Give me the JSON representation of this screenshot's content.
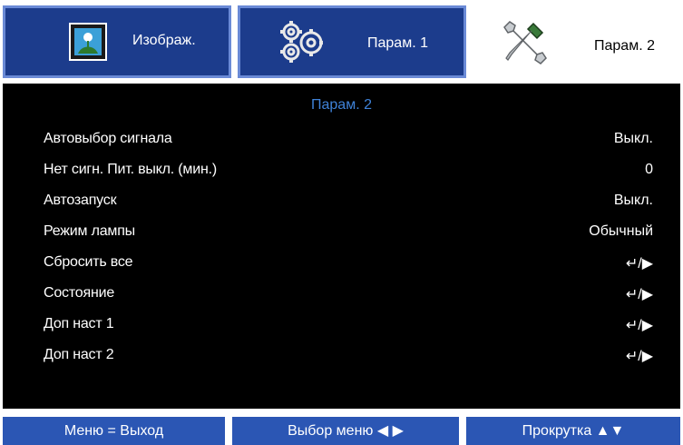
{
  "tabs": [
    {
      "label": "Изображ.",
      "icon": "image-icon"
    },
    {
      "label": "Парам. 1",
      "icon": "gears-icon"
    },
    {
      "label": "Парам. 2",
      "icon": "tools-icon"
    }
  ],
  "panel": {
    "title": "Парам. 2",
    "rows": [
      {
        "label": "Автовыбор сигнала",
        "value": "Выкл."
      },
      {
        "label": "Нет сигн. Пит. выкл. (мин.)",
        "value": "0"
      },
      {
        "label": "Автозапуск",
        "value": "Выкл."
      },
      {
        "label": "Режим лампы",
        "value": "Обычный"
      },
      {
        "label": "Сбросить все",
        "value": "↵/▶"
      },
      {
        "label": "Состояние",
        "value": "↵/▶"
      },
      {
        "label": "Доп наст 1",
        "value": "↵/▶"
      },
      {
        "label": "Доп наст 2",
        "value": "↵/▶"
      }
    ]
  },
  "hints": {
    "exit": "Меню = Выход",
    "select": "Выбор меню ◀ ▶",
    "scroll": "Прокрутка ▲▼"
  },
  "colors": {
    "accent": "#1c3c8c",
    "title": "#3f82d8",
    "hint_bar": "#2b56b4"
  }
}
